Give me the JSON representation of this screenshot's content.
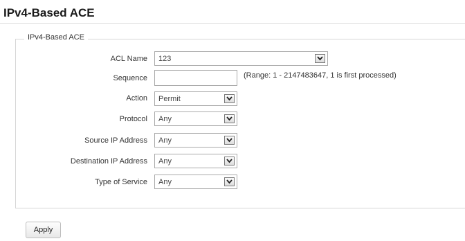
{
  "page": {
    "title": "IPv4-Based ACE"
  },
  "section": {
    "legend": "IPv4-Based ACE"
  },
  "form": {
    "acl_name": {
      "label": "ACL Name",
      "value": "123"
    },
    "sequence": {
      "label": "Sequence",
      "value": "",
      "hint": "(Range: 1 - 2147483647, 1 is first processed)"
    },
    "action": {
      "label": "Action",
      "value": "Permit"
    },
    "protocol": {
      "label": "Protocol",
      "value": "Any"
    },
    "source_ip": {
      "label": "Source IP Address",
      "value": "Any"
    },
    "destination_ip": {
      "label": "Destination IP Address",
      "value": "Any"
    },
    "type_of_service": {
      "label": "Type of Service",
      "value": "Any"
    }
  },
  "buttons": {
    "apply": "Apply"
  }
}
